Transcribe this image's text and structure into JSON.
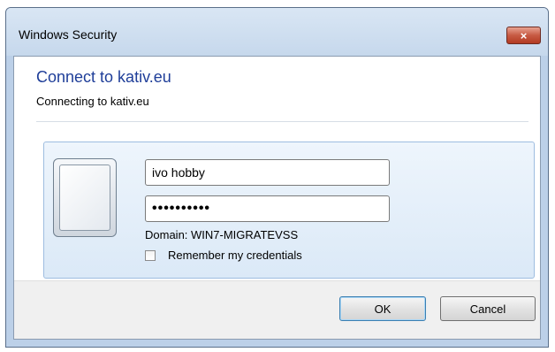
{
  "window": {
    "title": "Windows Security",
    "close_glyph": "×"
  },
  "header": {
    "heading": "Connect to kativ.eu",
    "subtext": "Connecting to kativ.eu"
  },
  "credentials": {
    "username_value": "ivo hobby",
    "password_masked": "••••••••••",
    "domain_text": "Domain: WIN7-MIGRATEVSS",
    "remember_label": "Remember my credentials",
    "remember_checked": false
  },
  "buttons": {
    "ok_label": "OK",
    "cancel_label": "Cancel"
  }
}
